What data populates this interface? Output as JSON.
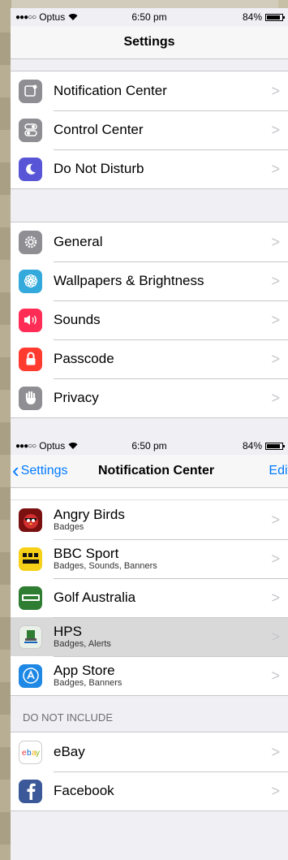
{
  "screen1": {
    "status": {
      "carrier": "Optus",
      "time": "6:50 pm",
      "battery": "84%"
    },
    "title": "Settings",
    "group1": [
      {
        "label": "Notification Center",
        "icon": "notification-center-icon",
        "color": "#8e8e93"
      },
      {
        "label": "Control Center",
        "icon": "control-center-icon",
        "color": "#8e8e93"
      },
      {
        "label": "Do Not Disturb",
        "icon": "moon-icon",
        "color": "#5856d6"
      }
    ],
    "group2": [
      {
        "label": "General",
        "icon": "gear-icon",
        "color": "#8e8e93"
      },
      {
        "label": "Wallpapers & Brightness",
        "icon": "flower-icon",
        "color": "#34aadc"
      },
      {
        "label": "Sounds",
        "icon": "speaker-icon",
        "color": "#ff2d55"
      },
      {
        "label": "Passcode",
        "icon": "lock-icon",
        "color": "#ff3b30"
      },
      {
        "label": "Privacy",
        "icon": "hand-icon",
        "color": "#8e8e93"
      }
    ]
  },
  "screen2": {
    "status": {
      "carrier": "Optus",
      "time": "6:50 pm",
      "battery": "84%"
    },
    "back_label": "Settings",
    "title": "Notification Center",
    "edit_label": "Edit",
    "apps": [
      {
        "title": "Angry Birds",
        "sub": "Badges",
        "icon": "angry-birds-icon",
        "color": "#7a1010"
      },
      {
        "title": "BBC Sport",
        "sub": "Badges, Sounds, Banners",
        "icon": "bbc-sport-icon",
        "color": "#f7d117"
      },
      {
        "title": "Golf Australia",
        "sub": "",
        "icon": "golf-icon",
        "color": "#2e7d32"
      },
      {
        "title": "HPS",
        "sub": "Badges, Alerts",
        "icon": "hps-icon",
        "color": "#e8f0e8"
      },
      {
        "title": "App Store",
        "sub": "Badges, Banners",
        "icon": "app-store-icon",
        "color": "#1e88e5"
      }
    ],
    "do_not_include_header": "DO NOT INCLUDE",
    "excluded": [
      {
        "title": "eBay",
        "icon": "ebay-icon",
        "color": "#ffffff"
      },
      {
        "title": "Facebook",
        "icon": "facebook-icon",
        "color": "#3b5998"
      }
    ]
  }
}
